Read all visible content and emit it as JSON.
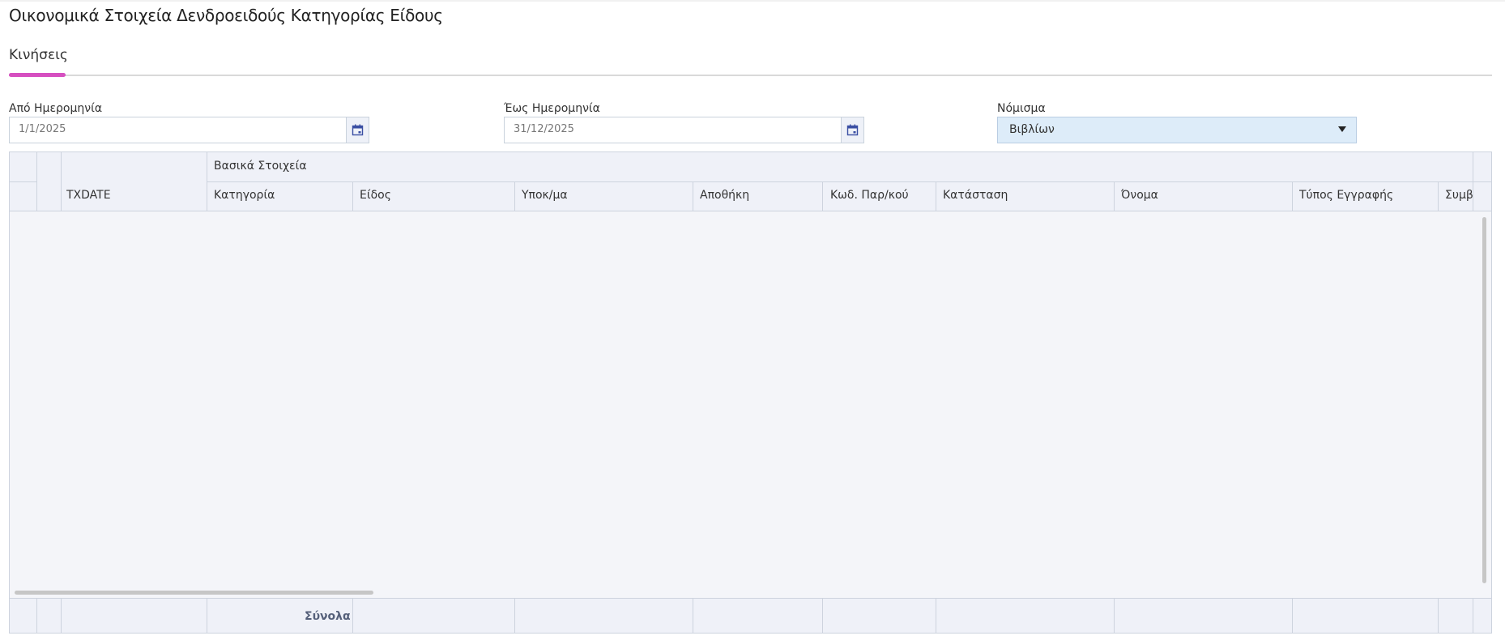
{
  "page": {
    "title": "Οικονομικά Στοιχεία Δενδροειδούς Κατηγορίας Είδους"
  },
  "tabs": [
    {
      "label": "Κινήσεις",
      "active": true
    }
  ],
  "colors": {
    "tab_accent": "#d64fc0",
    "select_bg": "#ddecf9",
    "grid_header_bg": "#eff1f8"
  },
  "filters": {
    "from_date": {
      "label": "Από Ημερομηνία",
      "value": "1/1/2025",
      "icon": "calendar-icon"
    },
    "to_date": {
      "label": "Έως Ημερομηνία",
      "value": "31/12/2025",
      "icon": "calendar-icon"
    },
    "currency": {
      "label": "Νόμισμα",
      "value": "Βιβλίων",
      "icon": "caret-down-icon"
    }
  },
  "grid": {
    "group_header": "Βασικά Στοιχεία",
    "columns": [
      "TXDATE",
      "Κατηγορία",
      "Είδος",
      "Υποκ/μα",
      "Αποθήκη",
      "Κωδ. Παρ/κού",
      "Κατάσταση",
      "Όνομα",
      "Τύπος Εγγραφής",
      "Συμβ"
    ],
    "rows": [],
    "footer": {
      "totals_label": "Σύνολα"
    }
  }
}
